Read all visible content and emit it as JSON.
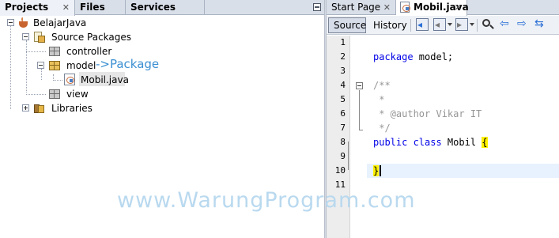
{
  "left_panel": {
    "tabs": [
      {
        "label": "Projects",
        "close": "✕"
      },
      {
        "label": "Files"
      },
      {
        "label": "Services"
      }
    ],
    "tree": {
      "project": "BelajarJava",
      "source_packages": "Source Packages",
      "packages": [
        "controller",
        "model",
        "view"
      ],
      "file": "Mobil.java",
      "libraries": "Libraries"
    },
    "annotation": "->Package"
  },
  "editor": {
    "tabs": [
      {
        "label": "Start Page",
        "close": "✕"
      },
      {
        "label": "Mobil.java",
        "close": "✕"
      }
    ],
    "toolbar": {
      "source_label": "Source",
      "history_label": "History"
    },
    "line_numbers": [
      "1",
      "2",
      "3",
      "4",
      "5",
      "6",
      "7",
      "8",
      "9",
      "10",
      "11"
    ],
    "code": {
      "line2_kw": "package",
      "line2_rest": " model;",
      "line4": "/**",
      "line5": " *",
      "line6": " * @author Vikar IT",
      "line7": " */",
      "line8_kw": "public class",
      "line8_name": " Mobil ",
      "line8_brace": "{",
      "line10_brace": "}"
    },
    "active_line": 10
  },
  "watermark": "www.WarungProgram.com",
  "icons": [
    "coffee-cup-project-icon",
    "source-packages-icon",
    "package-icon",
    "java-file-icon",
    "libraries-icon"
  ],
  "colors": {
    "keyword": "#0000e6",
    "comment": "#969696",
    "brace_highlight": "#fff200",
    "annotation": "#3b8fd1",
    "watermark": "#b9d9ef"
  }
}
